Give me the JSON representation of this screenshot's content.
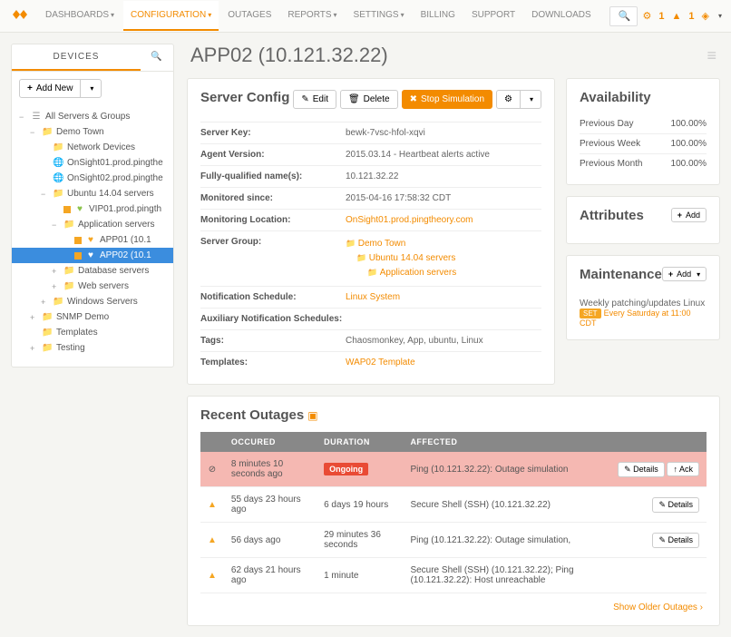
{
  "nav": {
    "items": [
      {
        "label": "DASHBOARDS",
        "caret": true
      },
      {
        "label": "CONFIGURATION",
        "caret": true,
        "active": true
      },
      {
        "label": "OUTAGES"
      },
      {
        "label": "REPORTS",
        "caret": true
      },
      {
        "label": "SETTINGS",
        "caret": true
      },
      {
        "label": "BILLING"
      },
      {
        "label": "SUPPORT"
      },
      {
        "label": "DOWNLOADS"
      }
    ],
    "alert1": "1",
    "alert2": "1"
  },
  "sidebar": {
    "tab_devices": "DEVICES",
    "add_new": "Add New",
    "tree": [
      {
        "indent": 0,
        "toggle": "−",
        "icon": "stack",
        "label": "All Servers & Groups"
      },
      {
        "indent": 1,
        "toggle": "−",
        "icon": "folder",
        "label": "Demo Town"
      },
      {
        "indent": 2,
        "toggle": "",
        "icon": "folder",
        "label": "Network Devices"
      },
      {
        "indent": 2,
        "toggle": "",
        "icon": "globe",
        "label": "OnSight01.prod.pingthe"
      },
      {
        "indent": 2,
        "toggle": "",
        "icon": "globe",
        "label": "OnSight02.prod.pingthe"
      },
      {
        "indent": 2,
        "toggle": "−",
        "icon": "folder",
        "label": "Ubuntu 14.04 servers"
      },
      {
        "indent": 3,
        "toggle": "",
        "icon": "heart-g",
        "status": true,
        "label": "VIP01.prod.pingth"
      },
      {
        "indent": 3,
        "toggle": "−",
        "icon": "folder",
        "label": "Application servers"
      },
      {
        "indent": 4,
        "toggle": "",
        "icon": "heart-o",
        "status": true,
        "label": "APP01 (10.1"
      },
      {
        "indent": 4,
        "toggle": "",
        "icon": "heart-o",
        "status": true,
        "label": "APP02 (10.1",
        "selected": true
      },
      {
        "indent": 3,
        "toggle": "+",
        "icon": "folder",
        "label": "Database servers"
      },
      {
        "indent": 3,
        "toggle": "+",
        "icon": "folder",
        "label": "Web servers"
      },
      {
        "indent": 2,
        "toggle": "+",
        "icon": "folder",
        "label": "Windows Servers"
      },
      {
        "indent": 1,
        "toggle": "+",
        "icon": "folder",
        "label": "SNMP Demo"
      },
      {
        "indent": 1,
        "toggle": "",
        "icon": "folder",
        "label": "Templates"
      },
      {
        "indent": 1,
        "toggle": "+",
        "icon": "folder",
        "label": "Testing"
      }
    ]
  },
  "page": {
    "title": "APP02 (10.121.32.22)"
  },
  "config": {
    "heading": "Server Config",
    "btn_edit": "Edit",
    "btn_delete": "Delete",
    "btn_stop": "Stop Simulation",
    "rows": {
      "server_key_k": "Server Key:",
      "server_key_v": "bewk-7vsc-hfol-xqvi",
      "agent_k": "Agent Version:",
      "agent_v": "2015.03.14 - Heartbeat alerts active",
      "fqdn_k": "Fully-qualified name(s):",
      "fqdn_v": "10.121.32.22",
      "mon_since_k": "Monitored since:",
      "mon_since_v": "2015-04-16 17:58:32 CDT",
      "mon_loc_k": "Monitoring Location:",
      "mon_loc_v": "OnSight01.prod.pingtheory.com",
      "group_k": "Server Group:",
      "group_v": [
        "Demo Town",
        "Ubuntu 14.04 servers",
        "Application servers"
      ],
      "notif_k": "Notification Schedule:",
      "notif_v": "Linux System",
      "aux_k": "Auxiliary Notification Schedules:",
      "aux_v": "",
      "tags_k": "Tags:",
      "tags_v": "Chaosmonkey, App, ubuntu, Linux",
      "tmpl_k": "Templates:",
      "tmpl_v": "WAP02 Template"
    }
  },
  "avail": {
    "heading": "Availability",
    "rows": [
      {
        "k": "Previous Day",
        "v": "100.00%"
      },
      {
        "k": "Previous Week",
        "v": "100.00%"
      },
      {
        "k": "Previous Month",
        "v": "100.00%"
      }
    ]
  },
  "attr": {
    "heading": "Attributes",
    "btn_add": "Add"
  },
  "maint": {
    "heading": "Maintenance",
    "btn_add": "Add",
    "desc": "Weekly patching/updates Linux",
    "badge": "SET",
    "sched": "Every Saturday at 11:00 CDT"
  },
  "outages": {
    "heading": "Recent Outages",
    "cols": {
      "occurred": "OCCURED",
      "duration": "DURATION",
      "affected": "AFFECTED"
    },
    "rows": [
      {
        "icon": "⊘",
        "ongoing": true,
        "occurred": "8 minutes 10 seconds ago",
        "duration": "Ongoing",
        "affected": "Ping (10.121.32.22): Outage simulation",
        "details": true,
        "ack": true
      },
      {
        "icon": "▲",
        "occurred": "55 days 23 hours ago",
        "duration": "6 days 19 hours",
        "affected": "Secure Shell (SSH) (10.121.32.22)",
        "details": true
      },
      {
        "icon": "▲",
        "occurred": "56 days ago",
        "duration": "29 minutes 36 seconds",
        "affected": "Ping (10.121.32.22): Outage simulation,",
        "details": true
      },
      {
        "icon": "▲",
        "occurred": "62 days 21 hours ago",
        "duration": "1 minute",
        "affected": "Secure Shell (SSH) (10.121.32.22); Ping (10.121.32.22): Host unreachable"
      }
    ],
    "btn_details": "Details",
    "btn_ack": "Ack",
    "older": "Show Older Outages"
  }
}
